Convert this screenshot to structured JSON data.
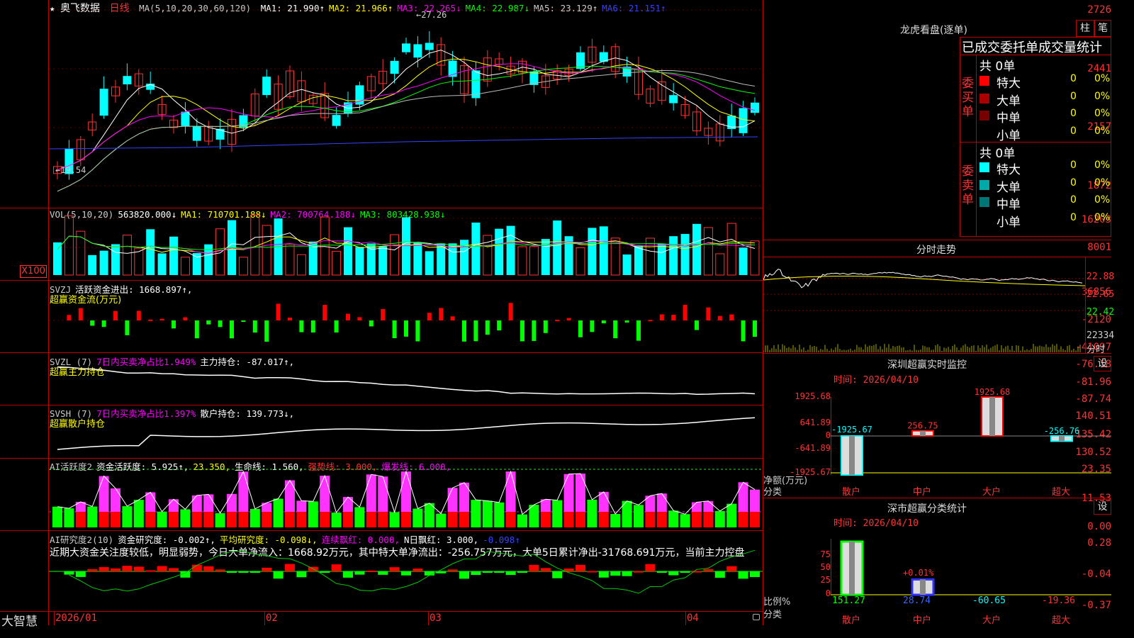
{
  "main_chart": {
    "star": "★",
    "stock_name": "奥飞数据",
    "period": "日线",
    "ma_params": "MA(5,10,20,30,60,120)",
    "ma_values": [
      {
        "text": "MA1: 21.990↑",
        "color": "#ffffff"
      },
      {
        "text": "MA2: 21.966↑",
        "color": "#ffff00"
      },
      {
        "text": "MA3: 22.265↓",
        "color": "#ff00ff"
      },
      {
        "text": "MA4: 22.987↓",
        "color": "#00ff00"
      },
      {
        "text": "MA5: 23.129↑",
        "color": "#cccccc"
      },
      {
        "text": "MA6: 21.151↑",
        "color": "#3344ff"
      }
    ],
    "y_labels": [
      "2726",
      "2441",
      "2157",
      "1872"
    ],
    "high_mark": "27.26",
    "low_mark": "19.54"
  },
  "volume_chart": {
    "legend": [
      {
        "text": "VOL(5,10,20)",
        "color": "#cccccc"
      },
      {
        "text": "563820.000↓",
        "color": "#ffffff"
      },
      {
        "text": "MA1: 710701.188↓",
        "color": "#ffff00"
      },
      {
        "text": "MA2: 700764.188↓",
        "color": "#ff00ff"
      },
      {
        "text": "MA3: 803428.938↓",
        "color": "#00ff00"
      }
    ],
    "y_labels": [
      "16203",
      "8001"
    ],
    "unit_label": "X100"
  },
  "svzj_chart": {
    "legend": [
      {
        "text": "SVZJ",
        "color": "#cccccc"
      },
      {
        "text": "活跃资金进出: 1668.897↑,",
        "color": "#ffffff"
      }
    ],
    "sub_title": "超赢资金流(万元)",
    "y_labels": [
      "36856",
      "-2120",
      "-41097"
    ]
  },
  "svzl_chart": {
    "legend": [
      {
        "text": "SVZL (7)",
        "color": "#cccccc"
      },
      {
        "text": "7日内买卖净占比1.949%",
        "color": "#ff00ff"
      },
      {
        "text": "主力持仓: -87.017↑,",
        "color": "#ffffff"
      }
    ],
    "sub_title": "超赢主力持仓",
    "y_labels": [
      "-76.18",
      "-81.96",
      "-87.74"
    ]
  },
  "svsh_chart": {
    "legend": [
      {
        "text": "SVSH (7)",
        "color": "#cccccc"
      },
      {
        "text": "7日内买卖净占比1.397%",
        "color": "#ff00ff"
      },
      {
        "text": "散户持仓: 139.773↓,",
        "color": "#ffffff"
      }
    ],
    "sub_title": "超赢散户持仓",
    "y_labels": [
      "140.51",
      "135.42",
      "130.52"
    ]
  },
  "ai_active_chart": {
    "legend": [
      {
        "text": "AI活跃度2",
        "color": "#cccccc"
      },
      {
        "text": "资金活跃度: 5.925↑,",
        "color": "#ffffff"
      },
      {
        "text": "23.350,",
        "color": "#ffff00"
      },
      {
        "text": "生命线: 1.560,",
        "color": "#ffffff"
      },
      {
        "text": "强势线: 3.000,",
        "color": "#ff3333"
      },
      {
        "text": "爆发线: 6.000,",
        "color": "#ff00ff"
      }
    ],
    "y_labels": [
      "23.35",
      "11.53",
      "0.00"
    ]
  },
  "ai_research_chart": {
    "legend": [
      {
        "text": "AI研究度2(10)",
        "color": "#cccccc"
      },
      {
        "text": "资金研究度: -0.002↑,",
        "color": "#ffffff"
      },
      {
        "text": "平均研究度: -0.098↓,",
        "color": "#ffff00"
      },
      {
        "text": "连续飘红: 0.000,",
        "color": "#ff00ff"
      },
      {
        "text": "N日飘红: 3.000,",
        "color": "#ffffff"
      },
      {
        "text": "-0.098↑",
        "color": "#3344ff"
      }
    ],
    "comment": "近期大资金关注度较低，明显弱势，今日大单净流入：1668.92万元，其中特大单净流出：-256.757万元，大单5日累计净出-31768.691万元，当前主力控盘",
    "y_labels": [
      "0.28",
      "-0.04",
      "-0.37"
    ]
  },
  "x_axis": {
    "logo": "大智慧",
    "labels": [
      "2026/01",
      "02",
      "03",
      "04"
    ]
  },
  "dragon_tiger": {
    "title": "龙虎看盘(逐单)",
    "btn_zhu": "柱",
    "btn_bi": "笔",
    "header": "已成交委托单成交量统计",
    "buy_side": "委买单",
    "sell_side": "委卖单",
    "buy_total": "共 0单",
    "sell_total": "共 0单",
    "buy_rows": [
      {
        "name": "特大",
        "count": "0",
        "pct": "0%",
        "color": "#ff0000"
      },
      {
        "name": "大单",
        "count": "0",
        "pct": "0%",
        "color": "#aa0000"
      },
      {
        "name": "中单",
        "count": "0",
        "pct": "0%",
        "color": "#770000"
      },
      {
        "name": "小单",
        "count": "0",
        "pct": "0%",
        "color": "#000000"
      }
    ],
    "sell_rows": [
      {
        "name": "特大",
        "count": "0",
        "pct": "0%",
        "color": "#00ffff"
      },
      {
        "name": "大单",
        "count": "0",
        "pct": "0%",
        "color": "#00aaaa"
      },
      {
        "name": "中单",
        "count": "0",
        "pct": "0%",
        "color": "#007777"
      },
      {
        "name": "小单",
        "count": "0",
        "pct": "0%",
        "color": "#000000"
      }
    ]
  },
  "intraday": {
    "title": "分时走势",
    "y_labels": [
      "22.88",
      "22.65",
      "22.42",
      "22334"
    ],
    "unit_label": "分时"
  },
  "sz_monitor": {
    "title": "深圳超赢实时监控",
    "settings": "设",
    "time_label": "时间: 2026/04/10",
    "y_labels": [
      "1925.68",
      "641.89",
      "0",
      "-641.89",
      "-1925.67"
    ],
    "axis_title": "净额(万元)",
    "axis_sub": "分类",
    "categories": [
      "散户",
      "中户",
      "大户",
      "超大"
    ],
    "values": [
      -1925.67,
      256.75,
      1925.68,
      -256.76
    ],
    "value_labels": [
      "-1925.67",
      "256.75",
      "1925.68",
      "-256.76"
    ]
  },
  "sz_classify": {
    "title": "深市超赢分类统计",
    "settings": "设",
    "time_label": "时间: 2026/04/10",
    "y_labels": [
      "75",
      "50",
      "25",
      "0"
    ],
    "axis_title": "比例%",
    "axis_sub": "分类",
    "top_label": "+0.01%",
    "categories": [
      "散户",
      "中户",
      "大户",
      "超大"
    ],
    "bar_percent": [
      100,
      28.74,
      0,
      0
    ],
    "value_labels": [
      "151.27",
      "28.74",
      "-60.65",
      "-19.36"
    ]
  },
  "colors": {
    "up": "#ff3333",
    "down": "#00ffff",
    "grid": "#bb0000",
    "green": "#00ff00",
    "magenta": "#ff00ff"
  }
}
